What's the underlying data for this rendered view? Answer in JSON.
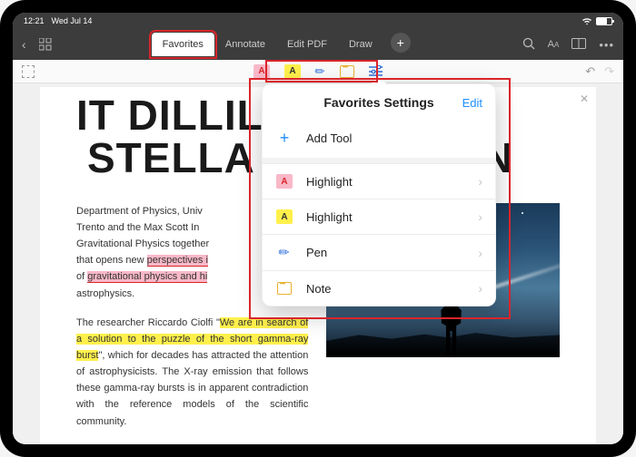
{
  "status": {
    "time": "12:21",
    "date": "Wed Jul 14"
  },
  "tabs": {
    "favorites": "Favorites",
    "annotate": "Annotate",
    "edit_pdf": "Edit PDF",
    "draw": "Draw"
  },
  "popover": {
    "title": "Favorites Settings",
    "edit": "Edit",
    "add_tool": "Add Tool",
    "items": [
      {
        "label": "Highlight",
        "type": "pink"
      },
      {
        "label": "Highlight",
        "type": "yellow"
      },
      {
        "label": "Pen",
        "type": "pen"
      },
      {
        "label": "Note",
        "type": "note"
      }
    ]
  },
  "document": {
    "title_line1": "IT DILLIL",
    "title_line2": "STELLA",
    "title_line2_end": "N",
    "para1_a": "Department of Physics, Univ",
    "para1_b": "Trento and the Max Scott In",
    "para1_c": "Gravitational Physics together",
    "para1_d": "that opens new ",
    "para1_hl1": "perspectives i",
    "para1_e": "of ",
    "para1_hl2": "gravitational physics and hi",
    "para1_f": "astrophysics.",
    "para2_a": "The researcher Riccardo Ciolfi \"",
    "para2_hl": "We are in search of a solution to the puzzle of the short gamma-ray burst",
    "para2_b": "\", which for decades has attracted the attention of astrophysicists. The X-ray emission that follows these gamma-ray bursts is in apparent contradiction with the reference models of the scientific community."
  },
  "glyphs": {
    "A": "A",
    "plus": "+",
    "chev": "›",
    "pen": "✎"
  }
}
